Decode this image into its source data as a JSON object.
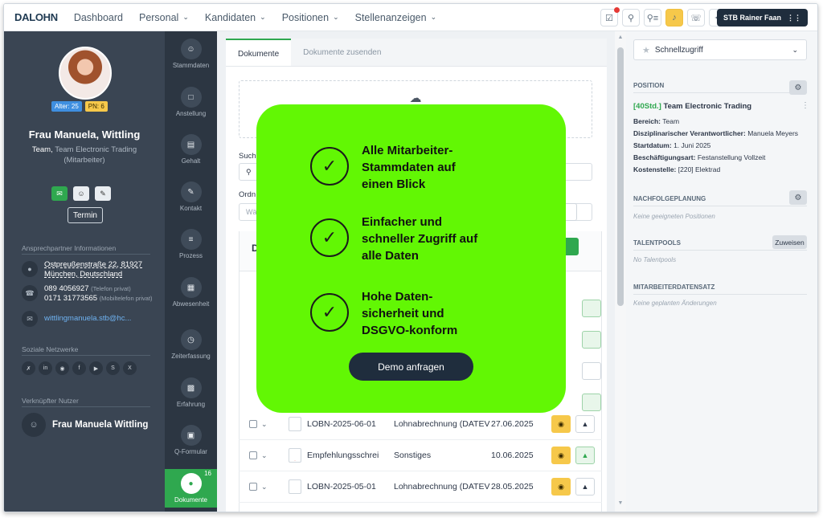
{
  "app": {
    "logo": "DALOHN"
  },
  "topnav": [
    {
      "label": "Dashboard",
      "dropdown": false
    },
    {
      "label": "Personal",
      "dropdown": true
    },
    {
      "label": "Kandidaten",
      "dropdown": true
    },
    {
      "label": "Positionen",
      "dropdown": true
    },
    {
      "label": "Stellenanzeigen",
      "dropdown": true
    }
  ],
  "toolbar_icons": [
    "checklist-icon",
    "search-icon",
    "search-list-icon",
    "bell-icon",
    "headset-icon",
    "pin-icon"
  ],
  "user_button": {
    "label": "STB Rainer Faan"
  },
  "profile": {
    "badges": {
      "age": "Alter: 25",
      "pn": "PN: 6"
    },
    "name": "Frau Manuela, Wittling",
    "team_prefix": "Team,",
    "team": "Team Electronic Trading",
    "role": "(Mitarbeiter)",
    "termin_label": "Termin",
    "contact_header": "Ansprechpartner Informationen",
    "address_line1": "Ostpreußenstraße 22, 81927",
    "address_line2": "München, Deutschland",
    "phone1": "089 4056927",
    "phone1_note": "(Telefon privat)",
    "phone2": "0171 31773565",
    "phone2_note": "(Mobiltelefon privat)",
    "email": "wittlingmanuela.stb@hc...",
    "social_header": "Soziale Netzwerke",
    "linked_header": "Verknüpfter Nutzer",
    "linked_name": "Frau Manuela Wittling"
  },
  "rail": [
    {
      "label": "Stammdaten",
      "icon": "person-icon"
    },
    {
      "label": "Anstellung",
      "icon": "document-icon"
    },
    {
      "label": "Gehalt",
      "icon": "wallet-icon"
    },
    {
      "label": "Kontakt",
      "icon": "edit-icon"
    },
    {
      "label": "Prozess",
      "icon": "list-icon"
    },
    {
      "label": "Abwesenheit",
      "icon": "calendar-icon"
    },
    {
      "label": "Zeiterfassung",
      "icon": "timer-icon"
    },
    {
      "label": "Erfahrung",
      "icon": "briefcase-icon"
    },
    {
      "label": "Q-Formular",
      "icon": "form-icon"
    },
    {
      "label": "Dokumente",
      "icon": "attachment-icon",
      "count": "16",
      "active": true
    }
  ],
  "main": {
    "tabs": [
      "Dokumente",
      "Dokumente zusenden"
    ],
    "search_label_partial": "Such",
    "order_label_partial": "Ordn",
    "input_placeholder_partial": "Wä",
    "list_header_partial": "D",
    "rows": [
      {
        "name": "LOBN-2025-06-01",
        "type": "Lohnabrechnung (DATEV",
        "date": "27.06.2025",
        "file": "doc"
      },
      {
        "name": "Empfehlungsschrei",
        "type": "Sonstiges",
        "date": "10.06.2025",
        "file": "pdf"
      },
      {
        "name": "LOBN-2025-05-01",
        "type": "Lohnabrechnung (DATEV",
        "date": "28.05.2025",
        "file": "doc"
      }
    ]
  },
  "right": {
    "quick_access": "Schnellzugriff",
    "position_header": "POSITION",
    "position_tag": "[40Std.]",
    "position_title": "Team Electronic Trading",
    "bereich_label": "Bereich:",
    "bereich": "Team",
    "vorg_label": "Disziplinarischer Verantwortlicher:",
    "vorg": "Manuela Meyers",
    "start_label": "Startdatum:",
    "start": "1. Juni 2025",
    "art_label": "Beschäftigungsart:",
    "art": "Festanstellung Vollzeit",
    "kst_label": "Kostenstelle:",
    "kst": "[220] Elektrad",
    "succession_header": "NACHFOLGEPLANUNG",
    "succession_empty": "Keine geeigneten Positionen",
    "talent_header": "TALENTPOOLS",
    "talent_button": "Zuweisen",
    "talent_empty": "No Talentpools",
    "record_header": "MITARBEITERDATENSATZ",
    "record_empty": "Keine geplanten Änderungen"
  },
  "promo": {
    "features": [
      "Alle Mitarbeiter-Stammdaten auf einen Blick",
      "Einfacher und schneller Zugriff auf alle Daten",
      "Hohe Daten-sicherheit und DSGVO-konform"
    ],
    "cta": "Demo anfragen",
    "bg_color": "#62f704"
  }
}
